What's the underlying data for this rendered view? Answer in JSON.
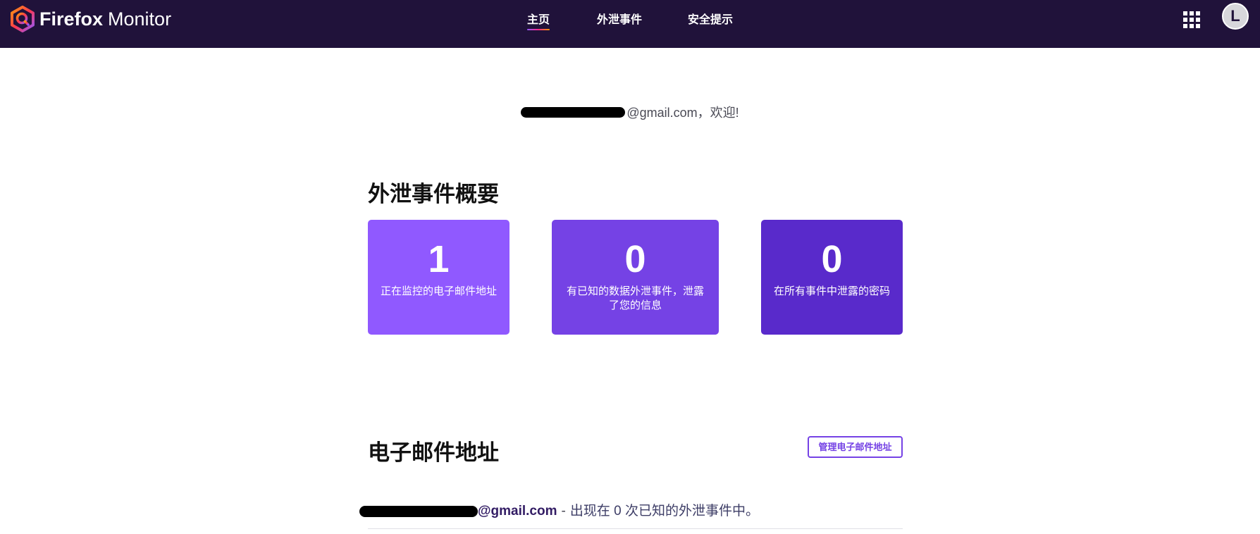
{
  "app": {
    "brand_first": "Firefox",
    "brand_second": "Monitor"
  },
  "nav": {
    "items": [
      {
        "label": "主页",
        "active": true
      },
      {
        "label": "外泄事件",
        "active": false
      },
      {
        "label": "安全提示",
        "active": false
      }
    ]
  },
  "user": {
    "avatar_initial": "L"
  },
  "greeting": {
    "text": "@gmail.com，欢迎!"
  },
  "summary": {
    "title": "外泄事件概要",
    "cards": [
      {
        "number": "1",
        "label": "正在监控的电子邮件地址",
        "color": "#9059ff"
      },
      {
        "number": "0",
        "label": "有已知的数据外泄事件，泄露了您的信息",
        "color": "#7542e5"
      },
      {
        "number": "0",
        "label": "在所有事件中泄露的密码",
        "color": "#592acb"
      }
    ]
  },
  "emails": {
    "title": "电子邮件地址",
    "manage_button": "管理电子邮件地址",
    "rows": [
      {
        "domain": "@gmail.com",
        "separator": "-",
        "status": "出现在 0 次已知的外泄事件中。"
      }
    ]
  },
  "colors": {
    "topbar_bg": "#20123a",
    "accent": "#7542e5"
  }
}
